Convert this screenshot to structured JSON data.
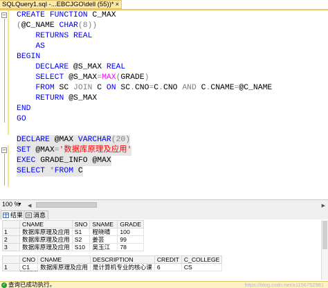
{
  "tab": {
    "title": "SQLQuery1.sql -...EBCJGO\\dell (55))*",
    "close": "×"
  },
  "editor": {
    "lines": [
      [
        {
          "t": "CREATE FUNCTION ",
          "c": "kw"
        },
        {
          "t": "C_MAX",
          "c": "pl"
        }
      ],
      [
        {
          "t": "(",
          "c": "gr"
        },
        {
          "t": "@C_NAME ",
          "c": "pl"
        },
        {
          "t": "CHAR",
          "c": "kw"
        },
        {
          "t": "(8))",
          "c": "gr"
        }
      ],
      [
        {
          "t": "    RETURNS REAL",
          "c": "kw"
        }
      ],
      [
        {
          "t": "    AS",
          "c": "kw"
        }
      ],
      [
        {
          "t": "BEGIN",
          "c": "kw"
        }
      ],
      [
        {
          "t": "    DECLARE ",
          "c": "kw"
        },
        {
          "t": "@S_MAX ",
          "c": "pl"
        },
        {
          "t": "REAL",
          "c": "kw"
        }
      ],
      [
        {
          "t": "    SELECT ",
          "c": "kw"
        },
        {
          "t": "@S_MAX",
          "c": "pl"
        },
        {
          "t": "=",
          "c": "gr"
        },
        {
          "t": "MAX",
          "c": "fn"
        },
        {
          "t": "(",
          "c": "gr"
        },
        {
          "t": "GRADE",
          "c": "pl"
        },
        {
          "t": ")",
          "c": "gr"
        }
      ],
      [
        {
          "t": "    FROM ",
          "c": "kw"
        },
        {
          "t": "SC ",
          "c": "pl"
        },
        {
          "t": "JOIN ",
          "c": "gr"
        },
        {
          "t": "C ",
          "c": "pl"
        },
        {
          "t": "ON ",
          "c": "kw"
        },
        {
          "t": "SC",
          "c": "pl"
        },
        {
          "t": ".",
          "c": "gr"
        },
        {
          "t": "CNO",
          "c": "pl"
        },
        {
          "t": "=",
          "c": "gr"
        },
        {
          "t": "C",
          "c": "pl"
        },
        {
          "t": ".",
          "c": "gr"
        },
        {
          "t": "CNO ",
          "c": "pl"
        },
        {
          "t": "AND ",
          "c": "gr"
        },
        {
          "t": "C",
          "c": "pl"
        },
        {
          "t": ".",
          "c": "gr"
        },
        {
          "t": "CNAME",
          "c": "pl"
        },
        {
          "t": "=",
          "c": "gr"
        },
        {
          "t": "@C_NAME",
          "c": "pl"
        }
      ],
      [
        {
          "t": "    RETURN ",
          "c": "kw"
        },
        {
          "t": "@S_MAX",
          "c": "pl"
        }
      ],
      [
        {
          "t": "END",
          "c": "kw"
        }
      ],
      [
        {
          "t": "GO",
          "c": "kw"
        }
      ],
      [],
      [
        {
          "t": "DECLARE ",
          "c": "kw"
        },
        {
          "t": "@MAX ",
          "c": "pl"
        },
        {
          "t": "VARCHAR",
          "c": "kw"
        },
        {
          "t": "(20)",
          "c": "gr"
        }
      ],
      [
        {
          "t": "SET ",
          "c": "kw"
        },
        {
          "t": "@MAX",
          "c": "pl"
        },
        {
          "t": "=",
          "c": "gr"
        },
        {
          "t": "'数据库原理及应用'",
          "c": "st"
        }
      ],
      [
        {
          "t": "EXEC ",
          "c": "kw"
        },
        {
          "t": "GRADE_INFO ",
          "c": "pl"
        },
        {
          "t": "@MAX",
          "c": "pl"
        }
      ],
      [
        {
          "t": "SELECT ",
          "c": "kw"
        },
        {
          "t": "*",
          "c": "gr"
        },
        {
          "t": "FROM ",
          "c": "kw"
        },
        {
          "t": "C",
          "c": "pl"
        }
      ]
    ]
  },
  "zoom": {
    "value": "100 %",
    "arrow": "▼"
  },
  "result_tabs": [
    {
      "label": "结果",
      "icon": "grid-icon"
    },
    {
      "label": "消息",
      "icon": "message-icon"
    }
  ],
  "grid1": {
    "headers": [
      "",
      "CNAME",
      "SNO",
      "SNAME",
      "GRADE"
    ],
    "rows": [
      [
        "1",
        "数据库原理及应用",
        "S1",
        "程晓晴",
        "100"
      ],
      [
        "2",
        "数据库原理及应用",
        "S2",
        "姜芸",
        "99"
      ],
      [
        "3",
        "数据库原理及应用",
        "S10",
        "吴玉江",
        "78"
      ]
    ]
  },
  "grid2": {
    "headers": [
      "",
      "CNO",
      "CNAME",
      "DESCRIPTION",
      "CREDIT",
      "C_COLLEGE"
    ],
    "rows": [
      [
        "1",
        "C1",
        "数据库原理及应用",
        "是计算机专业的核心课",
        "6",
        "CS"
      ]
    ]
  },
  "status": {
    "text": "查询已成功执行。",
    "watermark": "https://blog.csdn.net/a1156752961",
    "color_ok": "#2e9a2e"
  }
}
